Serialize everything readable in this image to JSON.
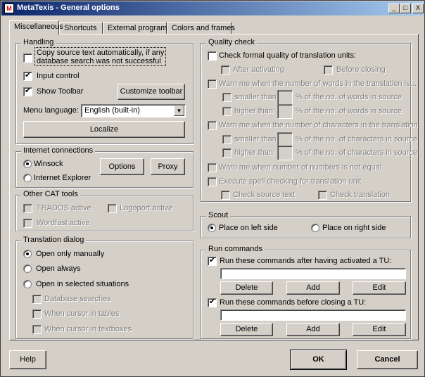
{
  "window": {
    "title": "MetaTexis - General options",
    "controls": {
      "minimize": "_",
      "maximize": "□",
      "close": "X"
    }
  },
  "tabs": [
    "Miscellaneous",
    "Shortcuts",
    "External programs",
    "Colors and frames"
  ],
  "handling": {
    "legend": "Handling",
    "copy_source_line1": "Copy source text automatically, if any",
    "copy_source_line2": "database search was not successful",
    "input_control": "Input control",
    "show_toolbar": "Show Toolbar",
    "customize_toolbar": "Customize toolbar",
    "menu_language_label": "Menu language:",
    "menu_language_value": "English (built-in)",
    "localize": "Localize"
  },
  "internet": {
    "legend": "Internet connections",
    "winsock": "Winsock",
    "internet_explorer": "Internet Explorer",
    "options": "Options",
    "proxy": "Proxy"
  },
  "cat_tools": {
    "legend": "Other CAT tools",
    "trados": "TRADOS active",
    "logoport": "Logoport active",
    "wordfast": "Wordfast active"
  },
  "translation_dialog": {
    "legend": "Translation dialog",
    "open_manually": "Open only manually",
    "open_always": "Open always",
    "open_selected": "Open in selected situations",
    "database_searches": "Database searches",
    "cursor_tables": "When cursor in tables",
    "cursor_textboxes": "When cursor in textboxes"
  },
  "quality": {
    "legend": "Quality check",
    "check_formal": "Check formal quality of translation units:",
    "after_activating": "After activating",
    "before_closing": "Before closing",
    "warn_words": "Warn me when the number of words in the translation is...",
    "smaller_than": "smaller than",
    "higher_than": "higher than",
    "pct_words": "% of the no. of words in source",
    "warn_chars": "Warn me when the number of characters in the translation",
    "pct_chars": "% of the no. of characters in source",
    "warn_numbers": "Warn me when number of numbers is not equal",
    "spell_check": "Execute spell checking for translation unit",
    "check_source": "Check source text",
    "check_translation": "Check translation"
  },
  "scout": {
    "legend": "Scout",
    "left": "Place on left side",
    "right": "Place on right side"
  },
  "run_commands": {
    "legend": "Run commands",
    "after_activated": "Run these commands after having activated a TU:",
    "before_closing": "Run these commands before closing a TU:",
    "delete": "Delete",
    "add": "Add",
    "edit": "Edit"
  },
  "footer": {
    "help": "Help",
    "ok": "OK",
    "cancel": "Cancel"
  }
}
